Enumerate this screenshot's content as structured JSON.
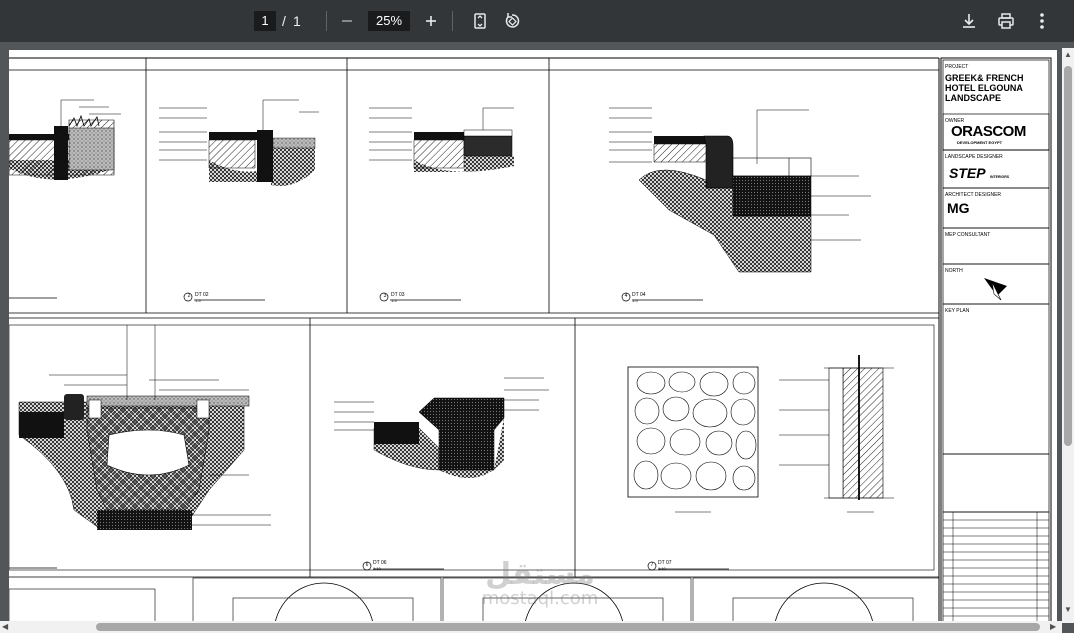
{
  "toolbar": {
    "current_page": "1",
    "page_separator": "/",
    "total_pages": "1",
    "zoom_level": "25%",
    "zoom_out_icon": "minus-icon",
    "zoom_in_icon": "plus-icon",
    "fit_page_icon": "fit-page-icon",
    "rotate_icon": "rotate-icon",
    "download_icon": "download-icon",
    "print_icon": "print-icon",
    "more_icon": "more-vert-icon"
  },
  "title_block": {
    "project_label": "PROJECT",
    "project_line1": "GREEK& FRENCH",
    "project_line2": "HOTEL ELGOUNA",
    "project_line3": "LANDSCAPE",
    "owner_label": "OWNER",
    "owner_logo": "ORASCOM",
    "owner_sub": "DEVELOPMENT EGYPT",
    "landscape_label": "LANDSCAPE DESIGNER",
    "landscape_logo": "STEP",
    "landscape_sub": "INTERIORS",
    "architect_label": "ARCHITECT DESIGNER",
    "architect_logo": "MG",
    "mep_label": "MEP CONSULTANT",
    "north_label": "NORTH",
    "keyplan_label": "KEY PLAN"
  },
  "details": {
    "dt02_num": "2",
    "dt02_label": "DT 02",
    "dt02_scale": "1:5",
    "dt03_num": "3",
    "dt03_label": "DT 03",
    "dt03_scale": "1:5",
    "dt04_num": "4",
    "dt04_label": "DT 04",
    "dt04_scale": "1:5",
    "dt06_num": "6",
    "dt06_label": "DT 06",
    "dt06_scale": "1:10",
    "dt07_num": "7",
    "dt07_label": "DT 07",
    "dt07_scale": "1:10"
  },
  "watermark": {
    "arabic": "مستقل",
    "latin": "mostaql.com"
  }
}
